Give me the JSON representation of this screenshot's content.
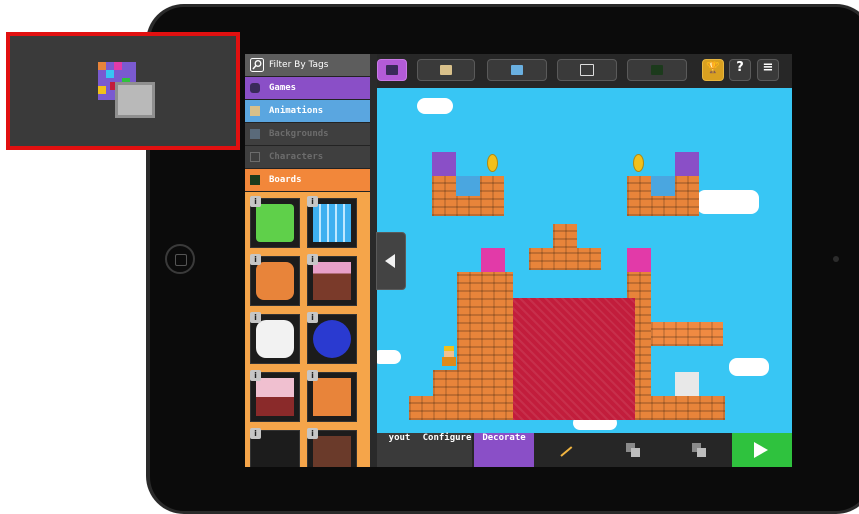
{
  "callout": {
    "icon": "copy-tiles-icon"
  },
  "sidebar": {
    "filter_label": "Filter By Tags",
    "categories": [
      {
        "label": "Games",
        "icon": "game-controller-icon",
        "color": "#8a4fc7"
      },
      {
        "label": "Animations",
        "icon": "film-icon",
        "color": "#5aa6e0"
      },
      {
        "label": "Backgrounds",
        "icon": "landscape-icon",
        "color": "#3f3f3f"
      },
      {
        "label": "Characters",
        "icon": "character-icon",
        "color": "#3f3f3f"
      },
      {
        "label": "Boards",
        "icon": "board-icon",
        "color": "#f2873a"
      }
    ],
    "tile_info_label": "i"
  },
  "toolbar": {
    "help_label": "?",
    "menu_label": "≡",
    "trophy_label": "🏆"
  },
  "bottom_bar": {
    "layout_label": "yout",
    "configure_label": "Configure",
    "decorate_label": "Decorate"
  },
  "colors": {
    "sky": "#38c6f4",
    "accent_purple": "#8a4fc7",
    "play_green": "#2fc23e",
    "callout_border": "#e11010"
  }
}
